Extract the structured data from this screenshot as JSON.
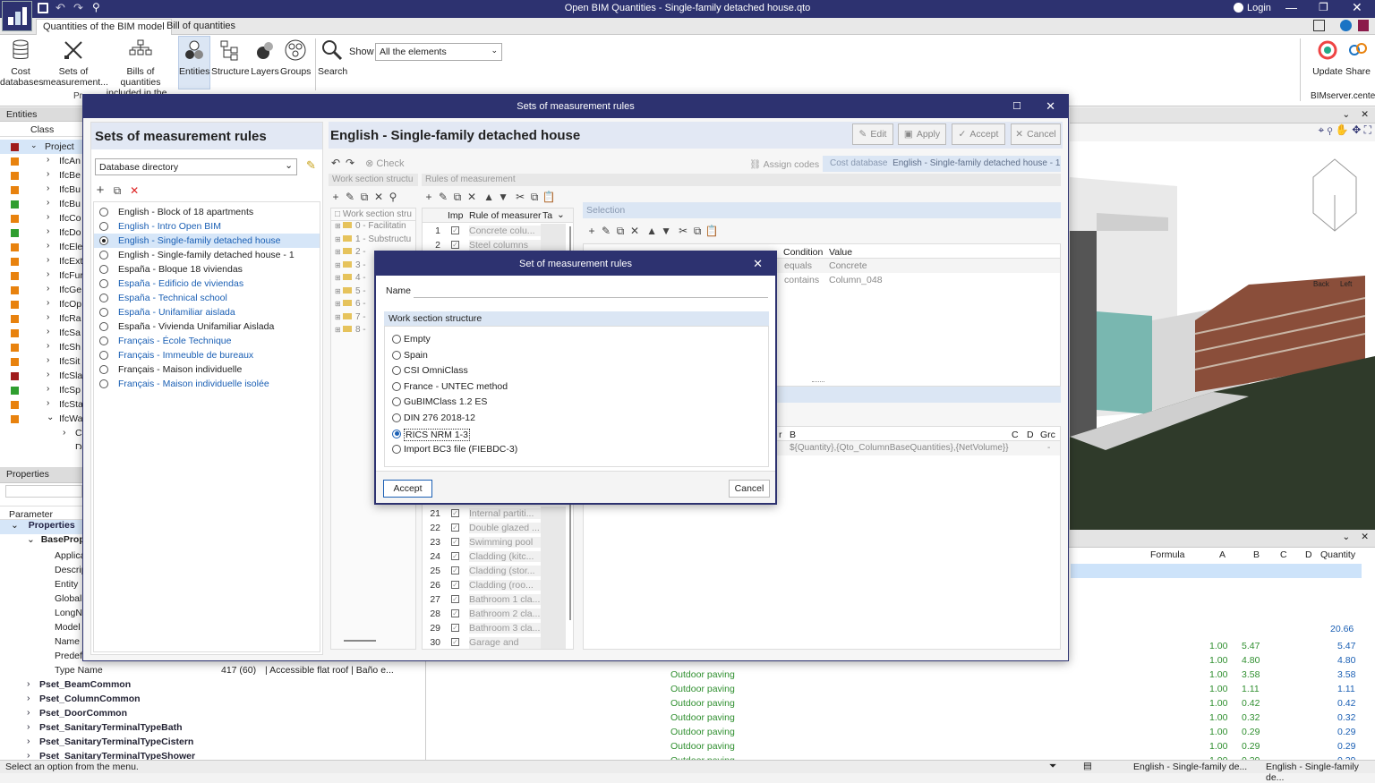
{
  "window": {
    "title": "Open BIM Quantities - Single-family detached house.qto",
    "login": "Login"
  },
  "tabs": [
    "Quantities of the BIM model",
    "Bill of quantities"
  ],
  "ribbon": {
    "cost_databases": [
      "Cost",
      "databases"
    ],
    "sets_of_measurement": [
      "Sets of",
      "measurement..."
    ],
    "bills": [
      "Bills of quantities",
      "included in the..."
    ],
    "entities": "Entities",
    "structure": "Structure",
    "layers": "Layers",
    "groups": "Groups",
    "search": "Search",
    "show_label": "Show",
    "show_value": "All the elements",
    "update": "Update",
    "share": "Share",
    "bimserver": "BIMserver.center",
    "group_frag": "Pr"
  },
  "left_panel": {
    "title": "Entities",
    "col": "Class",
    "root": "Project",
    "items": [
      "IfcAn",
      "IfcBe",
      "IfcBu",
      "IfcBu",
      "IfcCo",
      "IfcDo",
      "IfcEle",
      "IfcExt",
      "IfcFur",
      "IfcGe",
      "IfcOp",
      "IfcRa",
      "IfcSa",
      "IfcSh",
      "IfcSit",
      "IfcSla",
      "IfcSp",
      "IfcSta",
      "IfcWa"
    ],
    "colors": [
      "#e8820e",
      "#e8820e",
      "#e8820e",
      "#2f9e2f",
      "#e8820e",
      "#2f9e2f",
      "#e8820e",
      "#e8820e",
      "#e8820e",
      "#e8820e",
      "#e8820e",
      "#e8820e",
      "#e8820e",
      "#e8820e",
      "#e8820e",
      "#a01c1c",
      "#2f9e2f",
      "#e8820e",
      "#e8820e"
    ],
    "root_color": "#a01c1c",
    "sub1": "Cl",
    "sub2": "D"
  },
  "properties": {
    "title": "Properties",
    "col": "Parameter",
    "group": "Properties",
    "base": "BasePrope",
    "rows": [
      "Applica",
      "Descrip",
      "Entity",
      "Globall",
      "LongNa",
      "Model",
      "Name",
      "Predefi"
    ],
    "type_name": "Type Name",
    "type_count": "417 (60)",
    "type_value": "| Accessible flat roof | Baño e...",
    "psets": [
      "Pset_BeamCommon",
      "Pset_ColumnCommon",
      "Pset_DoorCommon",
      "Pset_SanitaryTerminalTypeBath",
      "Pset_SanitaryTerminalTypeCistern",
      "Pset_SanitaryTerminalTypeShower"
    ]
  },
  "status": {
    "text": "Select an option from the menu.",
    "right1": "English - Single-family de...",
    "right2": "English - Single-family de..."
  },
  "bottom_table": {
    "headers": [
      "Formula",
      "A",
      "B",
      "C",
      "D",
      "Quantity"
    ],
    "total": "20.66",
    "rows": [
      {
        "desc": "",
        "a": "1.00",
        "b": "5.47",
        "q": "5.47"
      },
      {
        "desc": "",
        "a": "1.00",
        "b": "4.80",
        "q": "4.80"
      },
      {
        "desc": "Outdoor paving",
        "a": "1.00",
        "b": "3.58",
        "q": "3.58"
      },
      {
        "desc": "Outdoor paving",
        "a": "1.00",
        "b": "1.11",
        "q": "1.11"
      },
      {
        "desc": "Outdoor paving",
        "a": "1.00",
        "b": "0.42",
        "q": "0.42"
      },
      {
        "desc": "Outdoor paving",
        "a": "1.00",
        "b": "0.32",
        "q": "0.32"
      },
      {
        "desc": "Outdoor paving",
        "a": "1.00",
        "b": "0.29",
        "q": "0.29"
      },
      {
        "desc": "Outdoor paving",
        "a": "1.00",
        "b": "0.29",
        "q": "0.29"
      },
      {
        "desc": "Outdoor paving",
        "a": "1.00",
        "b": "0.29",
        "q": "0.29"
      }
    ]
  },
  "viewcube": {
    "back": "Back",
    "left": "Left"
  },
  "main_dialog": {
    "title": "Sets of measurement rules",
    "left_heading": "Sets of measurement rules",
    "directory": "Database directory",
    "sets": [
      {
        "label": "English - Block of 18 apartments",
        "blue": false
      },
      {
        "label": "English - Intro Open BIM",
        "blue": true
      },
      {
        "label": "English - Single-family detached house",
        "blue": true
      },
      {
        "label": "English - Single-family detached house - 1",
        "blue": false
      },
      {
        "label": "España - Bloque 18 viviendas",
        "blue": false
      },
      {
        "label": "España - Edificio de viviendas",
        "blue": true
      },
      {
        "label": "España - Technical school",
        "blue": true
      },
      {
        "label": "España - Unifamiliar aislada",
        "blue": true
      },
      {
        "label": "España - Vivienda Unifamiliar Aislada",
        "blue": false
      },
      {
        "label": "Français - École Technique",
        "blue": true
      },
      {
        "label": "Français - Immeuble de bureaux",
        "blue": true
      },
      {
        "label": "Français - Maison individuelle",
        "blue": false
      },
      {
        "label": "Français - Maison individuelle isolée",
        "blue": true
      }
    ],
    "right_heading": "English - Single-family detached house",
    "edit": "Edit",
    "apply": "Apply",
    "accept": "Accept",
    "cancel": "Cancel",
    "check": "Check",
    "assign_codes": "Assign codes",
    "cost_db_label": "Cost database",
    "cost_db_value": "English - Single-family detached house - 1",
    "wss_header": "Work section structu",
    "rules_header": "Rules of measurement",
    "wss_col": "Work section stru",
    "wss_items": [
      "0 - Facilitatin",
      "1 - Substructu",
      "2 -",
      "3 -",
      "4 -",
      "5 -",
      "6 -",
      "7 -",
      "8 -"
    ],
    "rules_cols": [
      "Imp",
      "Rule of measurer",
      "Ta"
    ],
    "rules_top": [
      {
        "n": "1",
        "label": "Concrete colu..."
      },
      {
        "n": "2",
        "label": "Steel columns"
      }
    ],
    "rules_bottom": [
      {
        "n": "21",
        "label": "Internal partiti..."
      },
      {
        "n": "22",
        "label": "Double glazed ..."
      },
      {
        "n": "23",
        "label": "Swimming pool"
      },
      {
        "n": "24",
        "label": "Cladding (kitc..."
      },
      {
        "n": "25",
        "label": "Cladding (stor..."
      },
      {
        "n": "26",
        "label": "Cladding (roo..."
      },
      {
        "n": "27",
        "label": "Bathroom 1 cla..."
      },
      {
        "n": "28",
        "label": "Bathroom 2 cla..."
      },
      {
        "n": "29",
        "label": "Bathroom 3 cla..."
      },
      {
        "n": "30",
        "label": "Garage and sto..."
      }
    ],
    "selection": "Selection",
    "cond_cols": [
      "Condition",
      "Value"
    ],
    "conditions": [
      {
        "c": "equals",
        "v": "Concrete"
      },
      {
        "c": "contains",
        "v": "Column_048"
      }
    ],
    "formula_cols": [
      "B",
      "C",
      "D",
      "Grc"
    ],
    "formula_frag": "r",
    "formula_value": "${Quantity},{Qto_ColumnBaseQuantities},{NetVolume}}",
    "formula_dash": "-"
  },
  "sub_dialog": {
    "title": "Set of measurement rules",
    "name_label": "Name",
    "name_value": "",
    "wss_title": "Work section structure",
    "options": [
      "Empty",
      "Spain",
      "CSI OmniClass",
      "France - UNTEC method",
      "GuBIMClass 1.2 ES",
      "DIN 276 2018-12",
      "RICS NRM 1-3",
      "Import BC3 file (FIEBDC-3)"
    ],
    "selected": "RICS NRM 1-3",
    "accept": "Accept",
    "cancel": "Cancel"
  }
}
